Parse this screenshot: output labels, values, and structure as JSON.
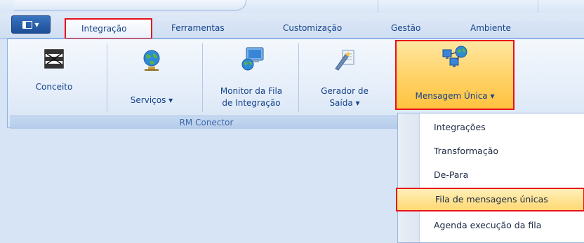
{
  "tabs": [
    {
      "label": "Integração",
      "active": true
    },
    {
      "label": "Ferramentas"
    },
    {
      "label": "Customização"
    },
    {
      "label": "Gestão"
    },
    {
      "label": "Ambiente"
    }
  ],
  "ribbon": {
    "group_name": "RM Conector",
    "buttons": [
      {
        "label": "Conceito",
        "icon": "network-grid-icon"
      },
      {
        "label": "Serviços ▾",
        "icon": "globe-server-icon"
      },
      {
        "label_line1": "Monitor da Fila",
        "label_line2": "de Integração",
        "icon": "monitor-globe-icon"
      },
      {
        "label_line1": "Gerador de",
        "label_line2": "Saída ▾",
        "icon": "wizard-output-icon"
      },
      {
        "label": "Mensagem Única ▾",
        "icon": "computers-globe-icon",
        "highlighted": true
      }
    ]
  },
  "dropdown": {
    "items": [
      {
        "label": "Integrações"
      },
      {
        "label": "Transformação"
      },
      {
        "label": "De-Para"
      },
      {
        "label": "Fila de mensagens únicas",
        "highlighted": true
      },
      {
        "label": "Agenda execução da fila"
      }
    ]
  },
  "colors": {
    "highlight_border": "#e8101c",
    "ribbon_text": "#15428b",
    "hover_fill": "#ffd873"
  }
}
